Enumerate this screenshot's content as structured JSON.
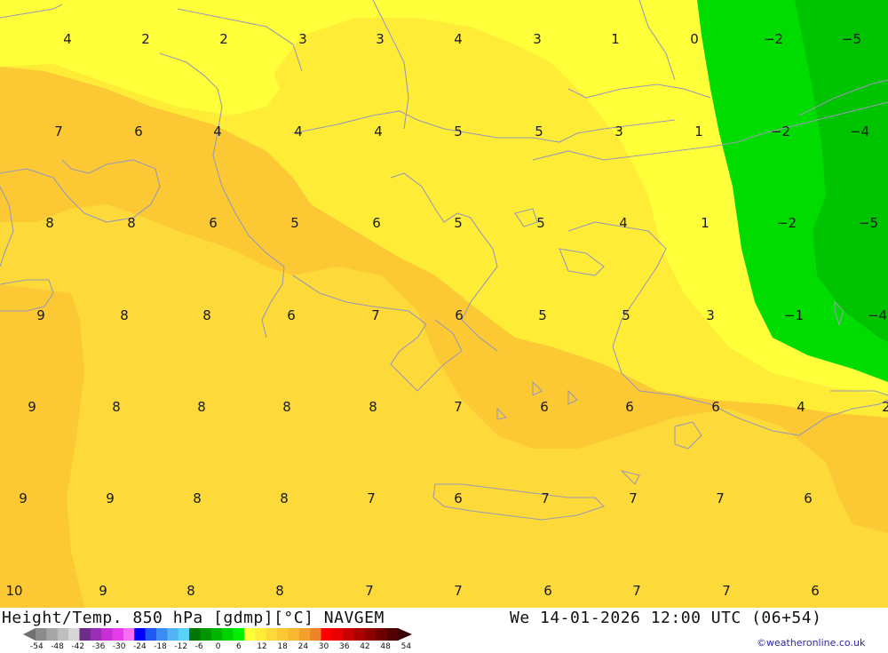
{
  "map": {
    "temperature_labels": [
      {
        "text": "4",
        "lon": 0,
        "row": 0
      },
      {
        "text": "2",
        "row": 0
      },
      {
        "text": "2",
        "row": 0
      },
      {
        "text": "3",
        "row": 0
      },
      {
        "text": "3",
        "row": 0
      },
      {
        "text": "4",
        "row": 0
      },
      {
        "text": "3",
        "row": 0
      },
      {
        "text": "1",
        "row": 0
      },
      {
        "text": "0",
        "row": 0
      },
      {
        "text": "−2",
        "row": 0
      },
      {
        "text": "−5",
        "row": 0
      },
      {
        "text": "7",
        "row": 1
      },
      {
        "text": "6",
        "row": 1
      },
      {
        "text": "4",
        "row": 1
      },
      {
        "text": "4",
        "row": 1
      },
      {
        "text": "4",
        "row": 1
      },
      {
        "text": "5",
        "row": 1
      },
      {
        "text": "5",
        "row": 1
      },
      {
        "text": "3",
        "row": 1
      },
      {
        "text": "1",
        "row": 1
      },
      {
        "text": "−2",
        "row": 1
      },
      {
        "text": "−4",
        "row": 1
      },
      {
        "text": "8",
        "row": 2
      },
      {
        "text": "8",
        "row": 2
      },
      {
        "text": "6",
        "row": 2
      },
      {
        "text": "5",
        "row": 2
      },
      {
        "text": "6",
        "row": 2
      },
      {
        "text": "5",
        "row": 2
      },
      {
        "text": "5",
        "row": 2
      },
      {
        "text": "4",
        "row": 2
      },
      {
        "text": "1",
        "row": 2
      },
      {
        "text": "−2",
        "row": 2
      },
      {
        "text": "−5",
        "row": 2
      },
      {
        "text": "9",
        "row": 3
      },
      {
        "text": "8",
        "row": 3
      },
      {
        "text": "8",
        "row": 3
      },
      {
        "text": "6",
        "row": 3
      },
      {
        "text": "7",
        "row": 3
      },
      {
        "text": "6",
        "row": 3
      },
      {
        "text": "5",
        "row": 3
      },
      {
        "text": "5",
        "row": 3
      },
      {
        "text": "3",
        "row": 3
      },
      {
        "text": "−1",
        "row": 3
      },
      {
        "text": "−4",
        "row": 3
      },
      {
        "text": "9",
        "row": 4
      },
      {
        "text": "8",
        "row": 4
      },
      {
        "text": "8",
        "row": 4
      },
      {
        "text": "8",
        "row": 4
      },
      {
        "text": "8",
        "row": 4
      },
      {
        "text": "7",
        "row": 4
      },
      {
        "text": "6",
        "row": 4
      },
      {
        "text": "6",
        "row": 4
      },
      {
        "text": "6",
        "row": 4
      },
      {
        "text": "4",
        "row": 4
      },
      {
        "text": "2",
        "row": 4
      },
      {
        "text": "9",
        "row": 5
      },
      {
        "text": "9",
        "row": 5
      },
      {
        "text": "8",
        "row": 5
      },
      {
        "text": "8",
        "row": 5
      },
      {
        "text": "7",
        "row": 5
      },
      {
        "text": "6",
        "row": 5
      },
      {
        "text": "7",
        "row": 5
      },
      {
        "text": "7",
        "row": 5
      },
      {
        "text": "7",
        "row": 5
      },
      {
        "text": "6",
        "row": 5
      },
      {
        "text": "10",
        "row": 6
      },
      {
        "text": "9",
        "row": 6
      },
      {
        "text": "8",
        "row": 6
      },
      {
        "text": "8",
        "row": 6
      },
      {
        "text": "7",
        "row": 6
      },
      {
        "text": "7",
        "row": 6
      },
      {
        "text": "6",
        "row": 6
      },
      {
        "text": "7",
        "row": 6
      },
      {
        "text": "7",
        "row": 6
      },
      {
        "text": "6",
        "row": 6
      }
    ],
    "colors": {
      "orange_light": "#fcc935",
      "orange_mid": "#fdd93a",
      "yellow": "#ffec37",
      "yellow_bright": "#ffff3a",
      "green": "#00dc00",
      "green_dark": "#00c300",
      "coast": "#9a9ab5"
    }
  },
  "footer": {
    "title": "Height/Temp. 850 hPa [gdmp][°C] NAVGEM",
    "date": "We 14-01-2026 12:00 UTC (06+54)",
    "credit": "©weatheronline.co.uk"
  },
  "colorbar": {
    "ticks": [
      "-54",
      "-48",
      "-42",
      "-36",
      "-30",
      "-24",
      "-18",
      "-12",
      "-6",
      "0",
      "6",
      "12",
      "18",
      "24",
      "30",
      "36",
      "42",
      "48",
      "54"
    ],
    "colors": [
      "#8c8c8c",
      "#a5a5a5",
      "#bebebe",
      "#d7d7d7",
      "#6e2c8a",
      "#9a2fb5",
      "#c62fd5",
      "#e43ce9",
      "#f56ef4",
      "#0000ff",
      "#1e5af0",
      "#3c8cf5",
      "#50b4f5",
      "#5ad2f5",
      "#007800",
      "#009600",
      "#00b400",
      "#00d200",
      "#00f000",
      "#ffff3a",
      "#ffec37",
      "#fdd93a",
      "#fcc935",
      "#f8b832",
      "#f5a02d",
      "#f08228",
      "#ff0000",
      "#e60000",
      "#c80000",
      "#aa0000",
      "#8c0000",
      "#6e0000",
      "#500000"
    ]
  }
}
